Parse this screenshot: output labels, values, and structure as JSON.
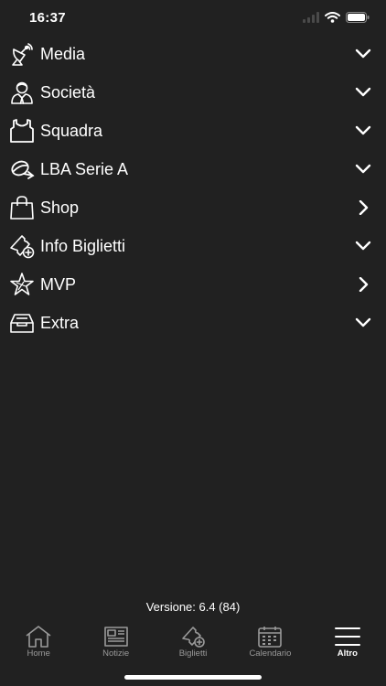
{
  "status_bar": {
    "time": "16:37"
  },
  "menu": {
    "items": [
      {
        "label": "Media",
        "icon": "satellite-dish-icon",
        "chevron": "chevron-down-icon"
      },
      {
        "label": "Società",
        "icon": "user-tie-icon",
        "chevron": "chevron-down-icon"
      },
      {
        "label": "Squadra",
        "icon": "jersey-icon",
        "chevron": "chevron-down-icon"
      },
      {
        "label": "LBA Serie A",
        "icon": "league-logo-icon",
        "chevron": "chevron-down-icon"
      },
      {
        "label": "Shop",
        "icon": "shopping-bag-icon",
        "chevron": "chevron-right-icon"
      },
      {
        "label": "Info Biglietti",
        "icon": "ticket-add-icon",
        "chevron": "chevron-down-icon"
      },
      {
        "label": "MVP",
        "icon": "star-icon",
        "chevron": "chevron-right-icon"
      },
      {
        "label": "Extra",
        "icon": "inbox-tray-icon",
        "chevron": "chevron-down-icon"
      }
    ]
  },
  "version": "Versione: 6.4 (84)",
  "tabbar": {
    "tabs": [
      {
        "label": "Home",
        "icon": "home-icon",
        "active": false
      },
      {
        "label": "Notizie",
        "icon": "newspaper-icon",
        "active": false
      },
      {
        "label": "Biglietti",
        "icon": "ticket-add-icon",
        "active": false
      },
      {
        "label": "Calendario",
        "icon": "calendar-icon",
        "active": false
      },
      {
        "label": "Altro",
        "icon": "hamburger-menu-icon",
        "active": true
      }
    ]
  },
  "colors": {
    "background": "#212121",
    "text": "#ffffff",
    "tab_inactive": "#9a9a9a"
  }
}
